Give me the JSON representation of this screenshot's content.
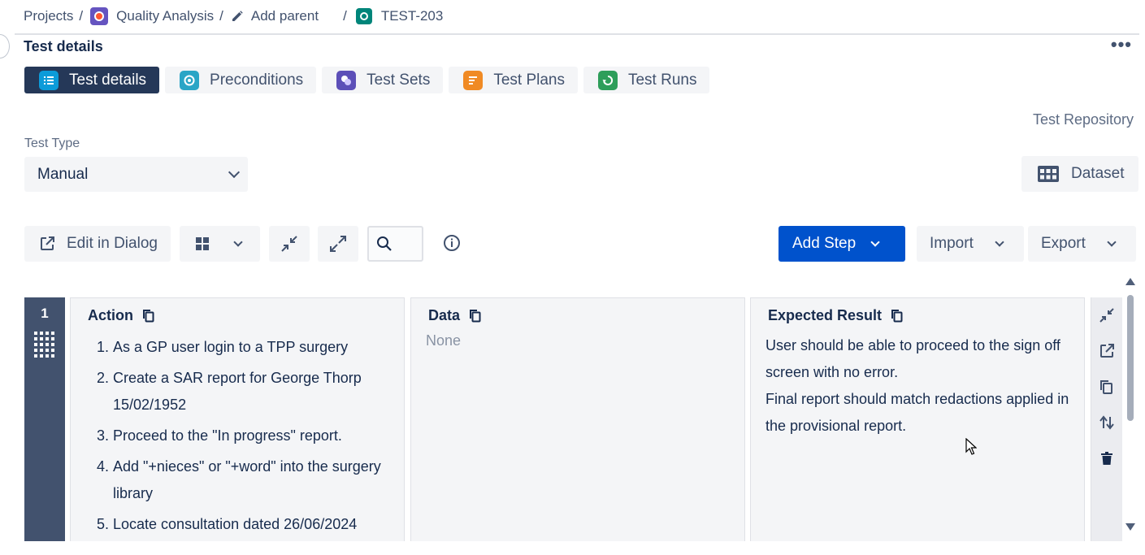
{
  "breadcrumb": {
    "projects": "Projects",
    "project_name": "Quality Analysis",
    "add_parent": "Add parent",
    "issue_key": "TEST-203",
    "separator": "/"
  },
  "section_title": "Test details",
  "more_label": "•••",
  "tabs": [
    {
      "label": "Test details",
      "icon": "list-icon",
      "color": "#0c9bd9",
      "active": true
    },
    {
      "label": "Preconditions",
      "icon": "precondition-icon",
      "color": "#2aa5c6",
      "active": false
    },
    {
      "label": "Test Sets",
      "icon": "test-sets-icon",
      "color": "#5c4fb8",
      "active": false
    },
    {
      "label": "Test Plans",
      "icon": "test-plans-icon",
      "color": "#f08a24",
      "active": false
    },
    {
      "label": "Test Runs",
      "icon": "test-runs-icon",
      "color": "#2e9e5a",
      "active": false
    }
  ],
  "test_repository": "Test Repository",
  "test_type": {
    "label": "Test Type",
    "value": "Manual"
  },
  "dataset_label": "Dataset",
  "toolbar": {
    "edit_in_dialog": "Edit in Dialog",
    "add_step": "Add Step",
    "import": "Import",
    "export": "Export"
  },
  "steps": [
    {
      "number": "1",
      "action_header": "Action",
      "data_header": "Data",
      "expected_header": "Expected Result",
      "actions": [
        {
          "n": "1.",
          "text": "As a GP user login to a TPP surgery"
        },
        {
          "n": "2.",
          "text": "Create a SAR report for George Thorp 15/02/1952"
        },
        {
          "n": "3.",
          "text": "Proceed to the \"In progress\" report."
        },
        {
          "n": "4.",
          "text": "Add \"+nieces\" or \"+word\" into the surgery library"
        },
        {
          "n": "5.",
          "text": "Locate consultation dated 26/06/2024"
        }
      ],
      "data": "None",
      "expected": [
        "User should be able to proceed to the sign off screen with no error.",
        "Final report should match redactions applied in the provisional report."
      ]
    }
  ],
  "colors": {
    "primary": "#0052cc",
    "active_tab": "#253858",
    "step_number_bg": "#42526e"
  }
}
